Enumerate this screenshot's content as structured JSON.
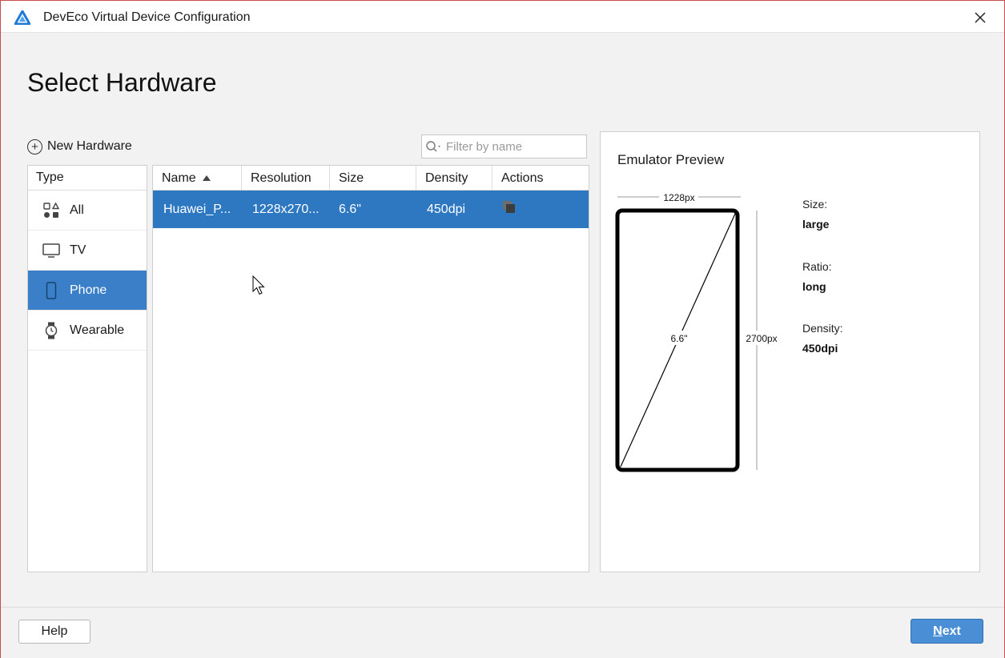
{
  "window": {
    "title": "DevEco Virtual Device Configuration"
  },
  "page": {
    "heading": "Select Hardware"
  },
  "toolbar": {
    "new_hardware_label": "New Hardware",
    "filter_placeholder": "Filter by name"
  },
  "type_list": {
    "header": "Type",
    "items": [
      {
        "label": "All",
        "icon": "grid-shapes-icon"
      },
      {
        "label": "TV",
        "icon": "tv-icon"
      },
      {
        "label": "Phone",
        "icon": "phone-icon",
        "selected": true
      },
      {
        "label": "Wearable",
        "icon": "watch-icon"
      }
    ]
  },
  "device_table": {
    "columns": [
      "Name",
      "Resolution",
      "Size",
      "Density",
      "Actions"
    ],
    "sort_column": "Name",
    "rows": [
      {
        "name": "Huawei_P...",
        "resolution": "1228x270...",
        "size": "6.6\"",
        "density": "450dpi",
        "action_icon": "copy-icon",
        "selected": true
      }
    ]
  },
  "preview": {
    "title": "Emulator Preview",
    "width_label": "1228px",
    "height_label": "2700px",
    "diagonal_label": "6.6\"",
    "specs": [
      {
        "key": "Size:",
        "value": "large"
      },
      {
        "key": "Ratio:",
        "value": "long"
      },
      {
        "key": "Density:",
        "value": "450dpi"
      }
    ]
  },
  "footer": {
    "help_label": "Help",
    "next_mnemonic": "N",
    "next_rest": "ext"
  },
  "colors": {
    "selection": "#2e78c2",
    "accent_button": "#4a8fd6",
    "window_border": "#c94b4b"
  }
}
